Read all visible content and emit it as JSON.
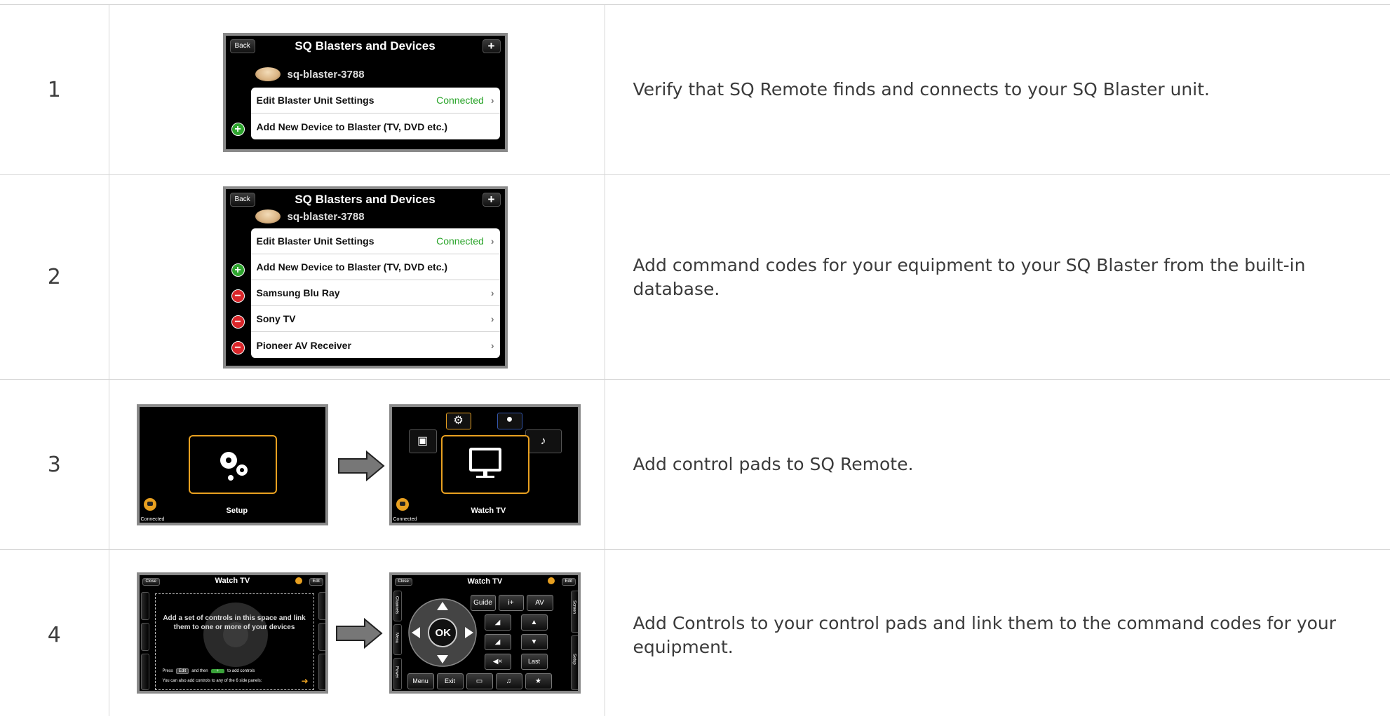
{
  "steps": [
    {
      "number": "1",
      "description": "Verify that SQ Remote finds and connects to your SQ Blaster unit.",
      "screen": {
        "back": "Back",
        "title": "SQ Blasters and Devices",
        "plus": "+",
        "blaster_name": "sq-blaster-3788",
        "rows": [
          {
            "label": "Edit Blaster Unit Settings",
            "status": "Connected",
            "chevron": "›"
          },
          {
            "label": "Add New Device to Blaster (TV, DVD etc.)",
            "icon": "add-circle-icon"
          }
        ]
      }
    },
    {
      "number": "2",
      "description": "Add command codes for your equipment to your SQ Blaster from the built-in database.",
      "screen": {
        "back": "Back",
        "title": "SQ Blasters and Devices",
        "plus": "+",
        "blaster_name": "sq-blaster-3788",
        "rows": [
          {
            "label": "Edit Blaster Unit Settings",
            "status": "Connected",
            "chevron": "›"
          },
          {
            "label": "Add New Device to Blaster (TV, DVD etc.)",
            "icon": "add-circle-icon"
          },
          {
            "label": "Samsung Blu Ray",
            "icon": "remove-circle-icon",
            "chevron": "›"
          },
          {
            "label": "Sony TV",
            "icon": "remove-circle-icon",
            "chevron": "›"
          },
          {
            "label": "Pioneer AV Receiver",
            "icon": "remove-circle-icon",
            "chevron": "›"
          }
        ]
      }
    },
    {
      "number": "3",
      "description": "Add control pads to SQ Remote.",
      "left_screen": {
        "pad_label": "Setup",
        "status": "Connected",
        "icon": "gears-icon"
      },
      "right_screen": {
        "pad_label": "Watch TV",
        "status": "Connected",
        "icon": "monitor-icon"
      }
    },
    {
      "number": "4",
      "description": "Add Controls to your control pads and link them to the command codes for your equipment.",
      "left_screen": {
        "close": "Close",
        "title": "Watch TV",
        "edit": "Edit",
        "hint": "Add a set of controls in this space and link them to one or more of your devices",
        "press": "Press",
        "press_edit": "Edit",
        "and_then": "and then",
        "to_add": "to add controls",
        "side_note": "You can also add controls to any of the 6 side panels:"
      },
      "right_screen": {
        "close": "Close",
        "title": "Watch TV",
        "edit": "Edit",
        "ok": "OK",
        "left_panels": [
          "Channels",
          "Menu",
          "Power"
        ],
        "right_panels": [
          "Screen",
          "Setup"
        ],
        "buttons_top": [
          "Guide",
          "i+",
          "AV"
        ],
        "buttons_mid": [
          "Last"
        ],
        "buttons_bottom": [
          "Menu",
          "Exit",
          "",
          "♫",
          "★"
        ]
      }
    }
  ]
}
